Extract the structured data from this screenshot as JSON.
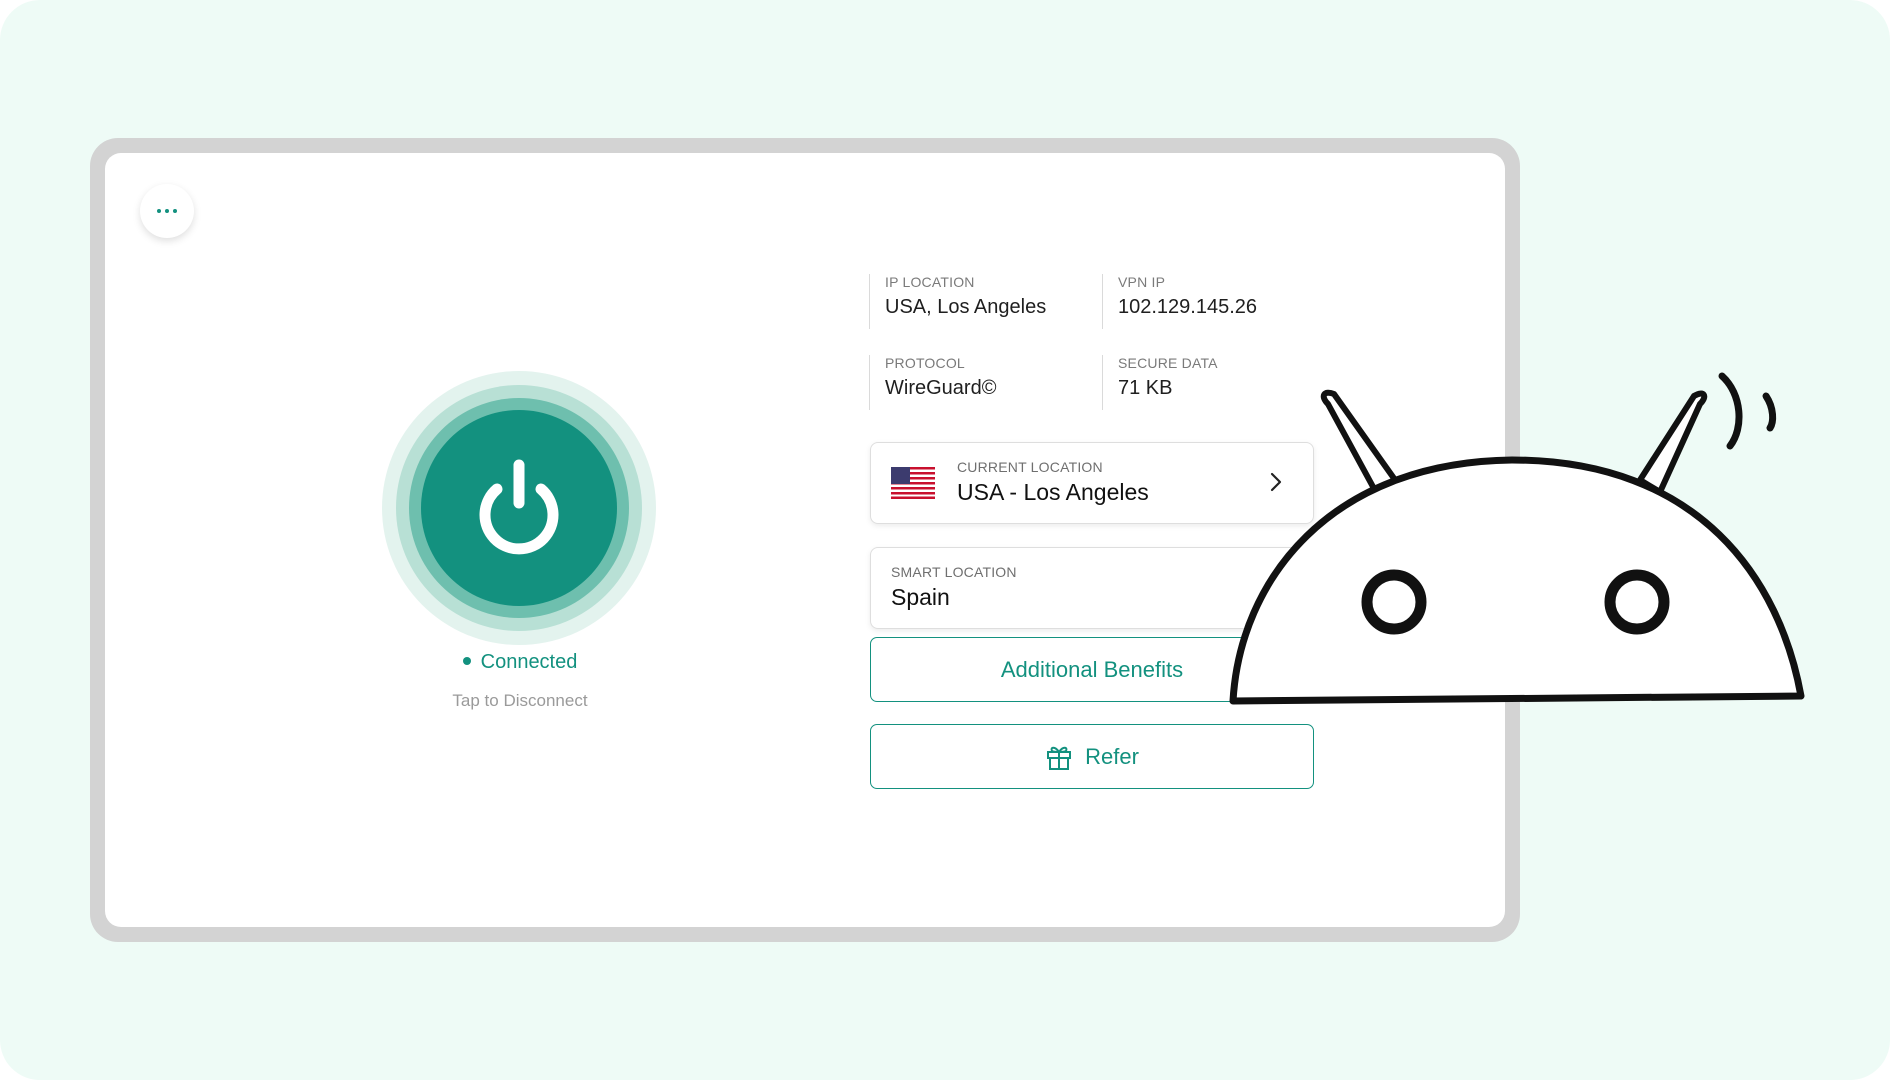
{
  "app": {
    "menu_icon": "more-horizontal-icon",
    "power_icon": "power-icon"
  },
  "status": {
    "connected_label": "Connected",
    "tap_hint": "Tap to Disconnect"
  },
  "info": {
    "ip_location_label": "IP LOCATION",
    "ip_location_value": "USA, Los Angeles",
    "vpn_ip_label": "VPN IP",
    "vpn_ip_value": "102.129.145.26",
    "protocol_label": "PROTOCOL",
    "protocol_value": "WireGuard©",
    "secure_data_label": "SECURE DATA",
    "secure_data_value": "71 KB"
  },
  "current_location": {
    "label": "CURRENT LOCATION",
    "value": "USA - Los Angeles",
    "flag_icon": "usa-flag-icon"
  },
  "smart_location": {
    "label": "SMART LOCATION",
    "value": "Spain"
  },
  "buttons": {
    "additional_benefits": "Additional Benefits",
    "refer": "Refer",
    "refer_icon": "gift-icon"
  },
  "colors": {
    "accent": "#13917f",
    "background": "#eefbf6",
    "tablet_frame": "#d3d3d3"
  }
}
